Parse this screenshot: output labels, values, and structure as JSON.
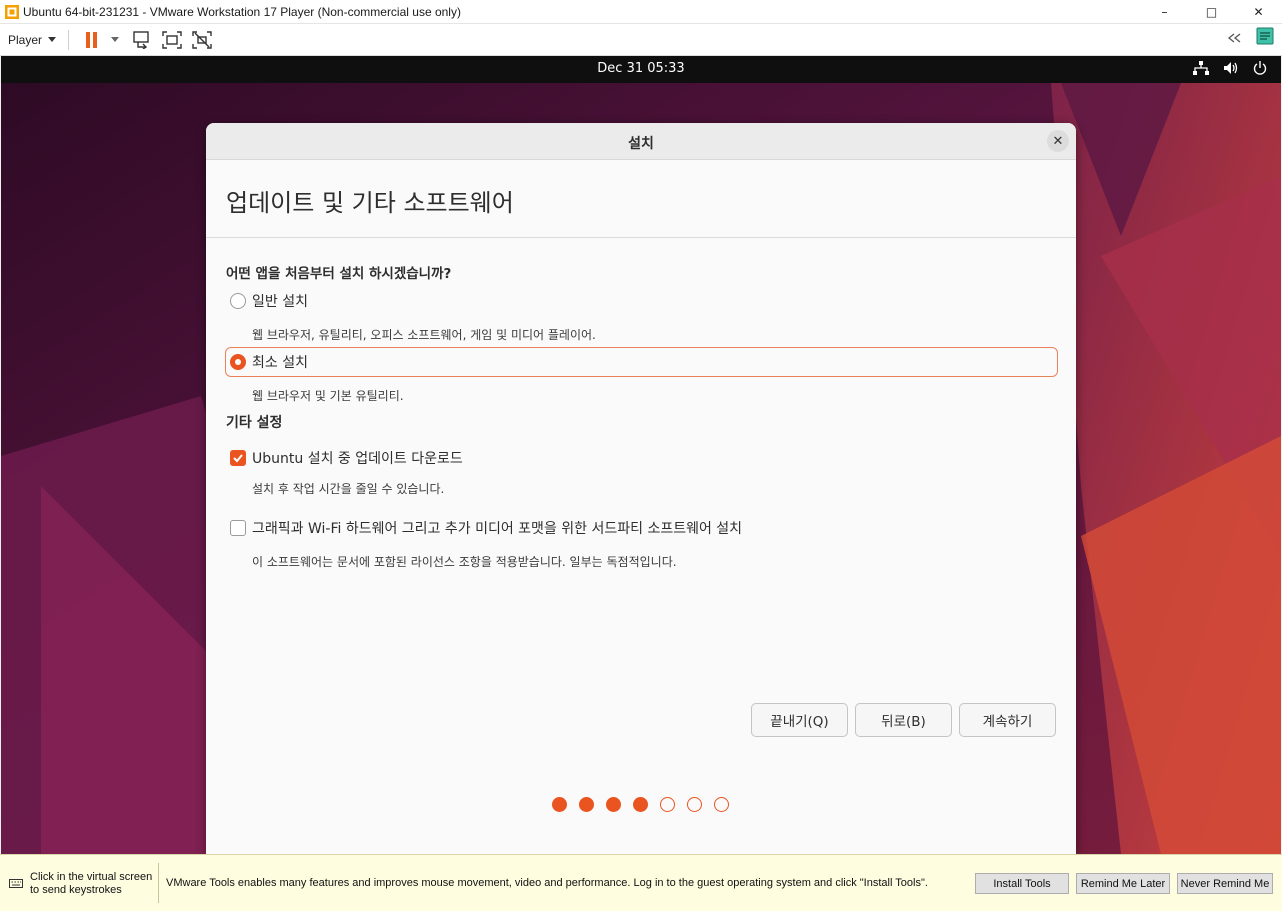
{
  "window": {
    "title": "Ubuntu 64-bit-231231 - VMware Workstation 17 Player (Non-commercial use only)",
    "controls": {
      "minimize": "–",
      "maximize": "□",
      "close": "✕"
    }
  },
  "toolbar": {
    "player_menu": "Player",
    "icons": [
      "pause-icon",
      "send-ctrl-alt-del-icon",
      "fit-guest-icon",
      "unity-icon",
      "collapse-icon",
      "notes-icon"
    ]
  },
  "ubuntu_topbar": {
    "clock": "Dec 31  05:33",
    "tray_icons": [
      "network-icon",
      "volume-icon",
      "power-icon"
    ]
  },
  "dialog": {
    "title": "설치",
    "close": "✕",
    "heading": "업데이트 및 기타 소프트웨어",
    "question": "어떤 앱을 처음부터 설치 하시겠습니까?",
    "options": [
      {
        "label": "일반 설치",
        "desc": "웹 브라우저, 유틸리티, 오피스  소프트웨어, 게임 및 미디어 플레이어.",
        "selected": false
      },
      {
        "label": "최소 설치",
        "desc": "웹 브라우저 및 기본 유틸리티.",
        "selected": true
      }
    ],
    "other_settings_label": "기타 설정",
    "checks": [
      {
        "label": "Ubuntu 설치 중 업데이트 다운로드",
        "desc": "설치 후 작업 시간을 줄일 수 있습니다.",
        "checked": true
      },
      {
        "label": "그래픽과 Wi-Fi 하드웨어 그리고 추가 미디어 포맷을 위한 서드파티 소프트웨어 설치",
        "desc": "이 소프트웨어는 문서에 포함된 라이선스 조항을 적용받습니다. 일부는 독점적입니다.",
        "checked": false
      }
    ],
    "buttons": {
      "quit": "끝내기(Q)",
      "back": "뒤로(B)",
      "continue": "계속하기"
    },
    "progress": {
      "total_steps": 7,
      "completed_steps": 4
    }
  },
  "message_bar": {
    "hint_line1": "Click in the virtual screen",
    "hint_line2": "to send keystrokes",
    "message": "VMware Tools enables many features and improves mouse movement, video and performance. Log in to the guest operating system and click \"Install Tools\".",
    "buttons": {
      "install": "Install Tools",
      "remind": "Remind Me Later",
      "never": "Never Remind Me"
    }
  },
  "colors": {
    "accent": "#e95420",
    "topbar": "#0f0f0f",
    "message_bar": "#fffde0"
  }
}
